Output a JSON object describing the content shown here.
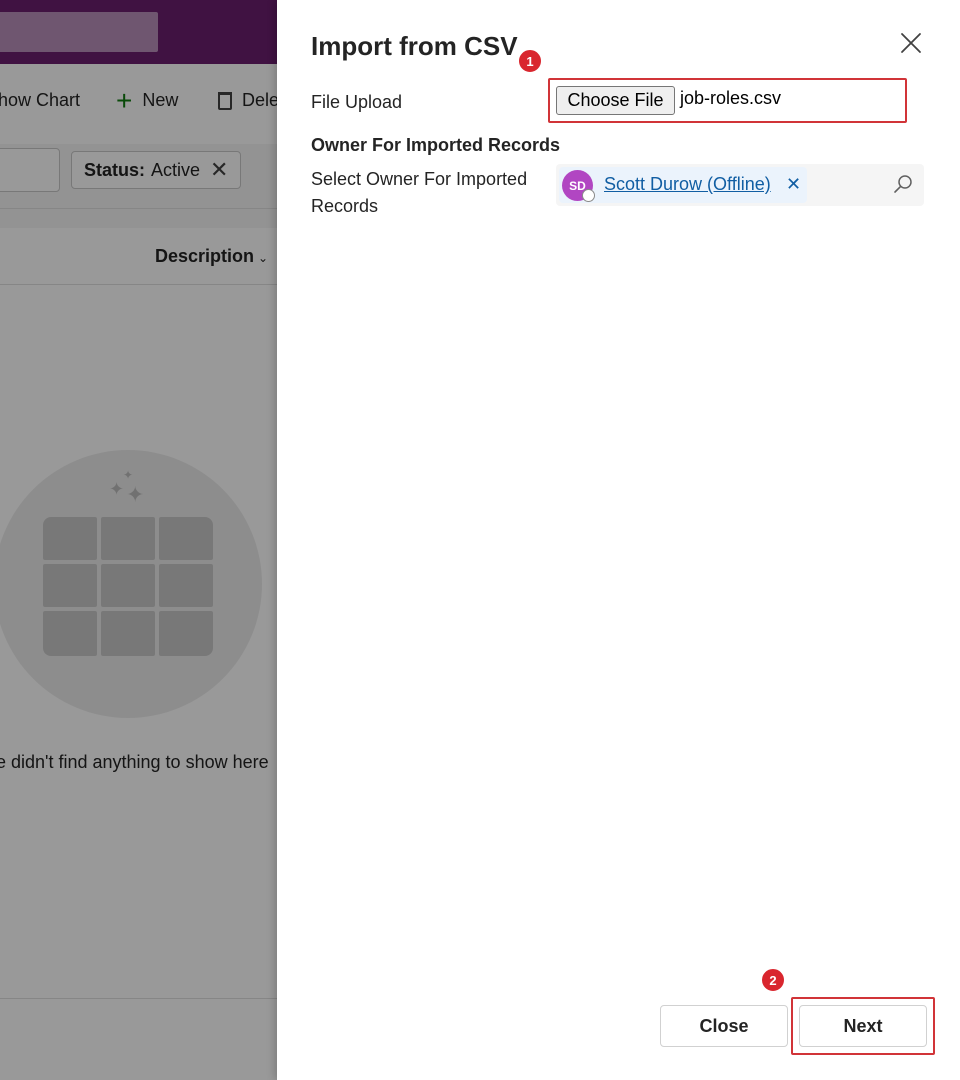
{
  "background": {
    "command_bar": {
      "show_chart_label": "how Chart",
      "new_label": "New",
      "delete_label": "Dele"
    },
    "filter_chip": {
      "key": "Status:",
      "value": "Active"
    },
    "grid": {
      "column_header": "Description"
    },
    "empty_state_text": "e didn't find anything to show here"
  },
  "dialog": {
    "title": "Import from CSV",
    "fields": {
      "file_upload_label": "File Upload",
      "choose_file_label": "Choose File",
      "file_name": "job-roles.csv",
      "section_heading": "Owner For Imported Records",
      "owner_label_line1": "Select Owner For Imported",
      "owner_label_line2": "Records",
      "owner": {
        "initials": "SD",
        "name": "Scott Durow (Offline)",
        "remove_glyph": "✕"
      }
    },
    "buttons": {
      "close_label": "Close",
      "next_label": "Next"
    }
  },
  "annotations": {
    "badge1": "1",
    "badge2": "2"
  },
  "colors": {
    "header_purple": "#6b1f6f",
    "avatar": "#b146c2",
    "link": "#115ea3",
    "highlight": "#d13438",
    "badge": "#d9262e"
  },
  "icons": [
    "close-icon",
    "search-icon",
    "plus-icon",
    "delete-icon",
    "filter-remove-icon",
    "chevron-down-icon",
    "grid-icon",
    "sparkle-icon"
  ]
}
